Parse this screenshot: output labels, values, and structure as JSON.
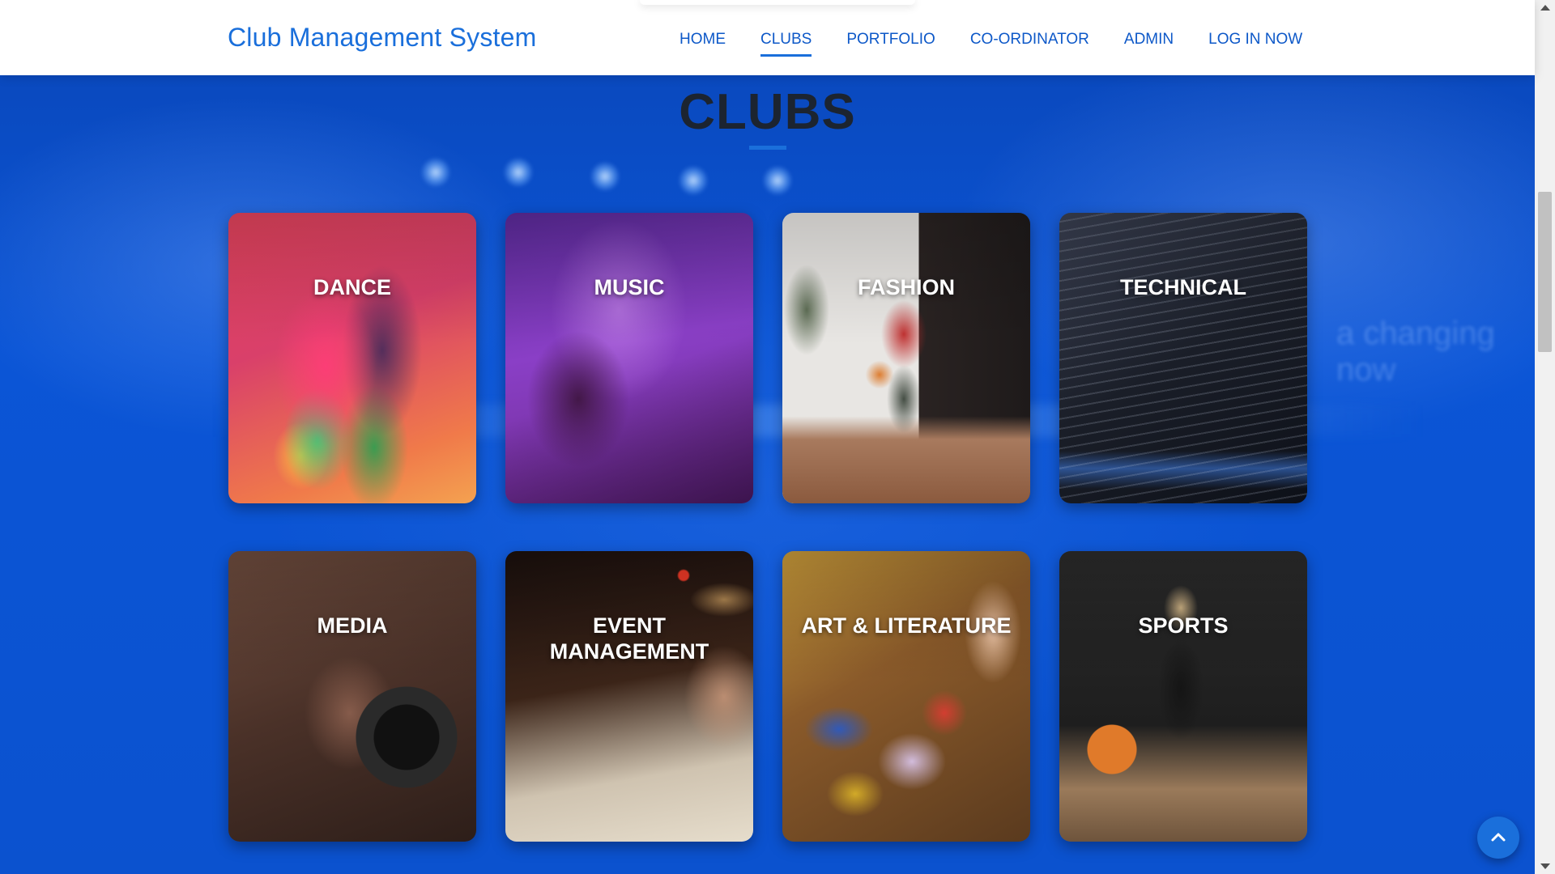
{
  "header": {
    "logo": "Club Management System",
    "nav": [
      {
        "label": "HOME",
        "active": false
      },
      {
        "label": "CLUBS",
        "active": true
      },
      {
        "label": "PORTFOLIO",
        "active": false
      },
      {
        "label": "CO-ORDINATOR",
        "active": false
      },
      {
        "label": "ADMIN",
        "active": false
      },
      {
        "label": "LOG IN NOW",
        "active": false
      }
    ]
  },
  "section": {
    "title": "CLUBS"
  },
  "clubs": [
    {
      "label_lines": [
        "DANCE"
      ],
      "image": "dancers-photo"
    },
    {
      "label_lines": [
        "MUSIC"
      ],
      "image": "singer-on-stage-photo"
    },
    {
      "label_lines": [
        "FASHION"
      ],
      "image": "runway-model-photo"
    },
    {
      "label_lines": [
        "TECHNICAL"
      ],
      "image": "code-on-screen-photo"
    },
    {
      "label_lines": [
        "MEDIA"
      ],
      "image": "photographer-with-camera-photo"
    },
    {
      "label_lines": [
        "EVENT",
        "MANAGEMENT"
      ],
      "image": "sound-mixer-photo"
    },
    {
      "label_lines": [
        "ART & LITERATURE"
      ],
      "image": "paint-palette-photo"
    },
    {
      "label_lines": [
        "SPORTS"
      ],
      "image": "basketball-player-photo"
    }
  ],
  "ui": {
    "back_to_top_icon": "chevron-up-icon",
    "accent": "#1a6fdb",
    "background": "#0b4fc4"
  }
}
